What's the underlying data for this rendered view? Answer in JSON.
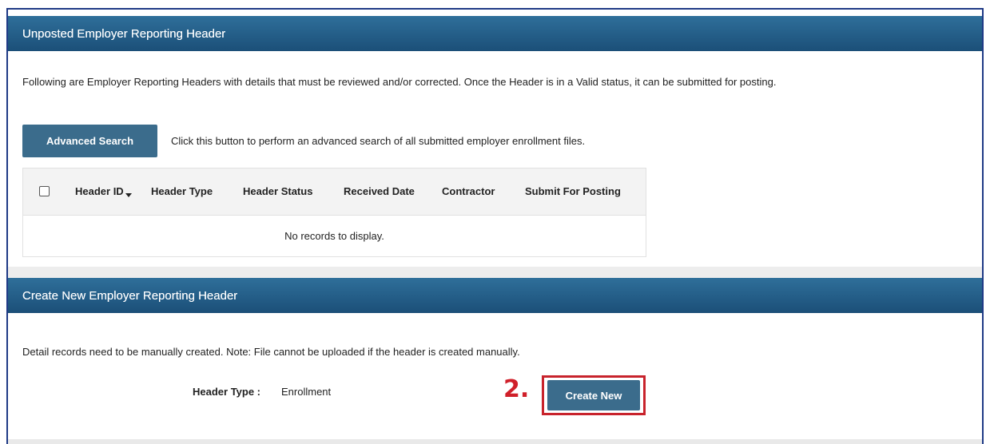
{
  "unposted": {
    "title": "Unposted Employer Reporting Header",
    "description": "Following are Employer Reporting Headers with details that must be reviewed and/or corrected. Once the Header is in a Valid status, it can be submitted for posting.",
    "advanced_search_label": "Advanced Search",
    "advanced_search_hint": "Click this button to perform an advanced search of all submitted employer enrollment files.",
    "columns": [
      "Header ID",
      "Header Type",
      "Header Status",
      "Received Date",
      "Contractor",
      "Submit For Posting"
    ],
    "empty_message": "No records to display."
  },
  "create": {
    "title": "Create New Employer Reporting Header",
    "description": "Detail records need to be manually created. Note: File cannot be uploaded if the header is created manually.",
    "header_type_label": "Header Type :",
    "header_type_value": "Enrollment",
    "create_button_label": "Create New",
    "step_marker": "2."
  },
  "colors": {
    "header_gradient_top": "#2f6f9a",
    "header_gradient_bottom": "#1b4f78",
    "button": "#3b6c8c",
    "highlight": "#c8232c",
    "frame": "#1f3a86"
  }
}
